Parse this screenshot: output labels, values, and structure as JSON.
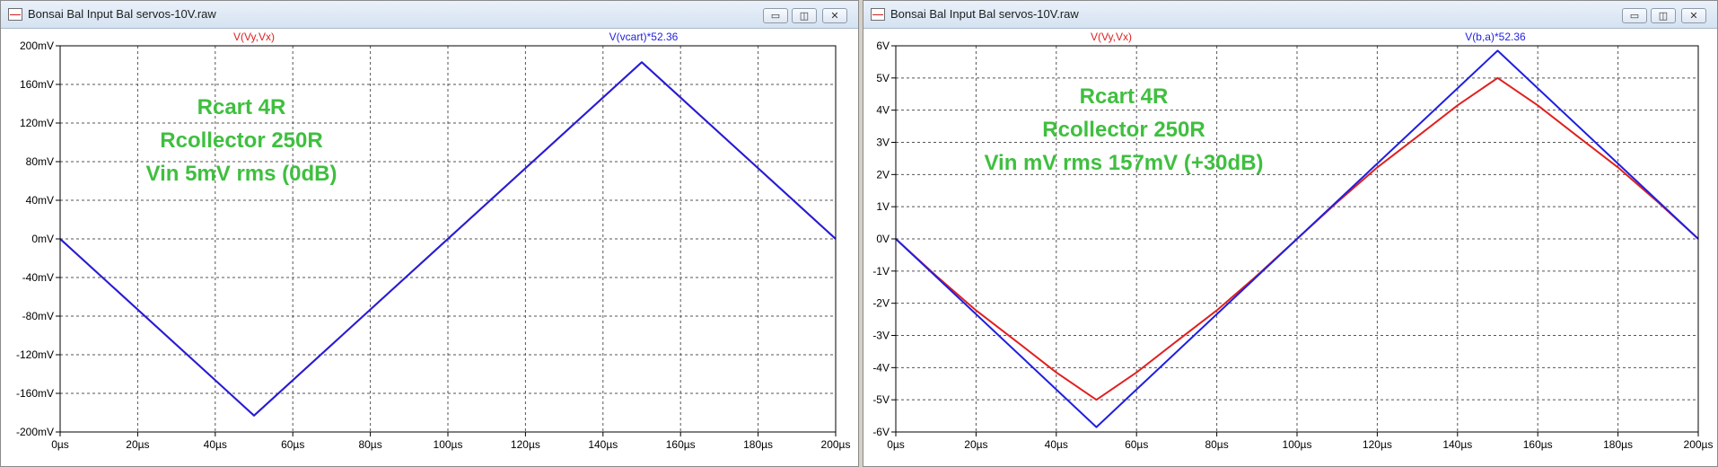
{
  "colors": {
    "red_trace": "#e02020",
    "blue_trace": "#1f1fe0",
    "annotation": "#3fbf3f",
    "grid": "#555555"
  },
  "windows": [
    {
      "title": "Bonsai Bal Input Bal servos-10V.raw",
      "controls": {
        "minimize_icon": "minimize-icon",
        "restore_icon": "restore-icon",
        "close_icon": "close-icon"
      },
      "trace_titles": {
        "red": "V(Vy,Vx)",
        "blue": "V(vcart)*52.36"
      },
      "annotation": [
        "Rcart 4R",
        "Rcollector 250R",
        "Vin 5mV rms (0dB)"
      ],
      "chart_data": {
        "type": "line",
        "xlabel": "",
        "ylabel": "",
        "x_ticks": [
          "0µs",
          "20µs",
          "40µs",
          "60µs",
          "80µs",
          "100µs",
          "120µs",
          "140µs",
          "160µs",
          "180µs",
          "200µs"
        ],
        "y_ticks": [
          "200mV",
          "160mV",
          "120mV",
          "80mV",
          "40mV",
          "0mV",
          "-40mV",
          "-80mV",
          "-120mV",
          "-160mV",
          "-200mV"
        ],
        "xlim": [
          0,
          200
        ],
        "ylim": [
          -200,
          200
        ],
        "grid": true,
        "series": [
          {
            "name": "V(Vy,Vx)",
            "color": "#e02020",
            "x": [
              0,
              50,
              150,
              200
            ],
            "y": [
              0,
              -183,
              183,
              0
            ]
          },
          {
            "name": "V(vcart)*52.36",
            "color": "#1f1fe0",
            "x": [
              0,
              50,
              150,
              200
            ],
            "y": [
              0,
              -183,
              183,
              0
            ]
          }
        ]
      }
    },
    {
      "title": "Bonsai Bal Input Bal servos-10V.raw",
      "controls": {
        "minimize_icon": "minimize-icon",
        "restore_icon": "restore-icon",
        "close_icon": "close-icon"
      },
      "trace_titles": {
        "red": "V(Vy,Vx)",
        "blue": "V(b,a)*52.36"
      },
      "annotation": [
        "Rcart 4R",
        "Rcollector 250R",
        "Vin mV rms 157mV (+30dB)"
      ],
      "chart_data": {
        "type": "line",
        "xlabel": "",
        "ylabel": "",
        "x_ticks": [
          "0µs",
          "20µs",
          "40µs",
          "60µs",
          "80µs",
          "100µs",
          "120µs",
          "140µs",
          "160µs",
          "180µs",
          "200µs"
        ],
        "y_ticks": [
          "6V",
          "5V",
          "4V",
          "3V",
          "2V",
          "1V",
          "0V",
          "-1V",
          "-2V",
          "-3V",
          "-4V",
          "-5V",
          "-6V"
        ],
        "xlim": [
          0,
          200
        ],
        "ylim": [
          -6,
          6
        ],
        "grid": true,
        "series": [
          {
            "name": "V(Vy,Vx)",
            "color": "#e02020",
            "x": [
              0,
              10,
              20,
              30,
              40,
              50,
              60,
              70,
              80,
              90,
              100,
              110,
              120,
              130,
              140,
              150,
              160,
              170,
              180,
              190,
              200
            ],
            "y": [
              0,
              -1.14,
              -2.22,
              -3.18,
              -4.15,
              -5.0,
              -4.15,
              -3.18,
              -2.22,
              -1.14,
              0,
              1.14,
              2.22,
              3.18,
              4.15,
              5.0,
              4.15,
              3.18,
              2.22,
              1.14,
              0
            ]
          },
          {
            "name": "V(b,a)*52.36",
            "color": "#1f1fe0",
            "x": [
              0,
              50,
              150,
              200
            ],
            "y": [
              0,
              -5.85,
              5.85,
              0
            ]
          }
        ]
      }
    }
  ]
}
